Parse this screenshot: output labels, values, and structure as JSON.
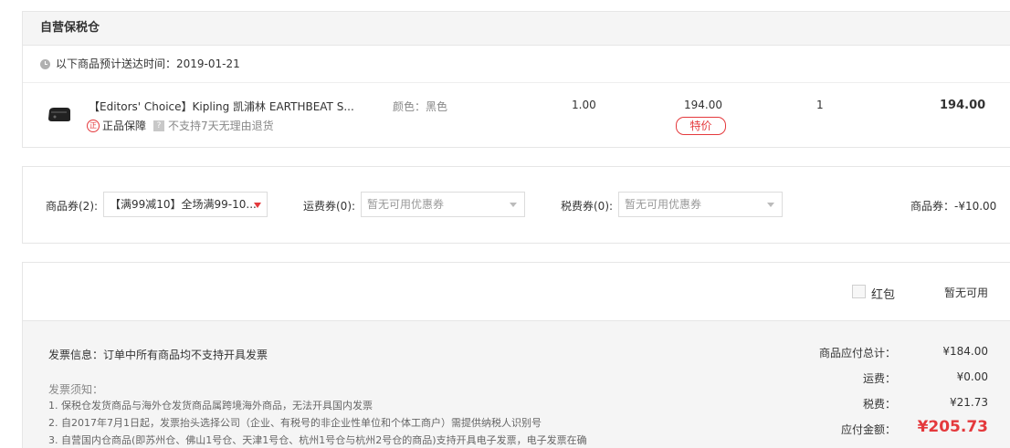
{
  "warehouse": {
    "title": "自营保税仓",
    "delivery_eta": "以下商品预计送达时间：2019-01-21",
    "item": {
      "name": "【Editors' Choice】Kipling 凯浦林 EARTHBEAT S...",
      "guarantee": "正品保障",
      "guarantee_icon_char": "正",
      "question_icon_char": "?",
      "return_policy": "不支持7天无理由退货",
      "color": "颜色：黑色",
      "tax_rate": "1.00",
      "price": "194.00",
      "price_tag": "特价",
      "quantity": "1",
      "subtotal": "194.00"
    }
  },
  "coupons": {
    "product_label": "商品券(2):",
    "product_selected": "【满99减10】全场满99-10...",
    "shipping_label": "运费券(0):",
    "shipping_placeholder": "暂无可用优惠券",
    "tax_label": "税费券(0):",
    "tax_placeholder": "暂无可用优惠券",
    "discount_text": "商品券：-¥10.00"
  },
  "red_packet": {
    "label": "红包",
    "status": "暂无可用"
  },
  "invoice": {
    "info": "发票信息：订单中所有商品均不支持开具发票",
    "notice_title": "发票须知：",
    "lines": [
      "1. 保税仓发货商品与海外仓发货商品属跨境海外商品，无法开具国内发票",
      "2. 自2017年7月1日起，发票抬头选择公司（企业、有税号的非企业性单位和个体工商户）需提供纳税人识别号",
      "3. 自营国内仓商品(即苏州仓、佛山1号仓、天津1号仓、杭州1号仓与杭州2号仓的商品)支持开具电子发票，电子发票在确"
    ]
  },
  "totals": {
    "goods_label": "商品应付总计：",
    "goods_value": "¥184.00",
    "shipping_label": "运费：",
    "shipping_value": "¥0.00",
    "tax_label": "税费：",
    "tax_value": "¥21.73",
    "payable_label": "应付金额：",
    "payable_value": "¥205.73"
  },
  "colors": {
    "accent_red": "#e4393c",
    "panel_bg": "#f5f5f5"
  }
}
